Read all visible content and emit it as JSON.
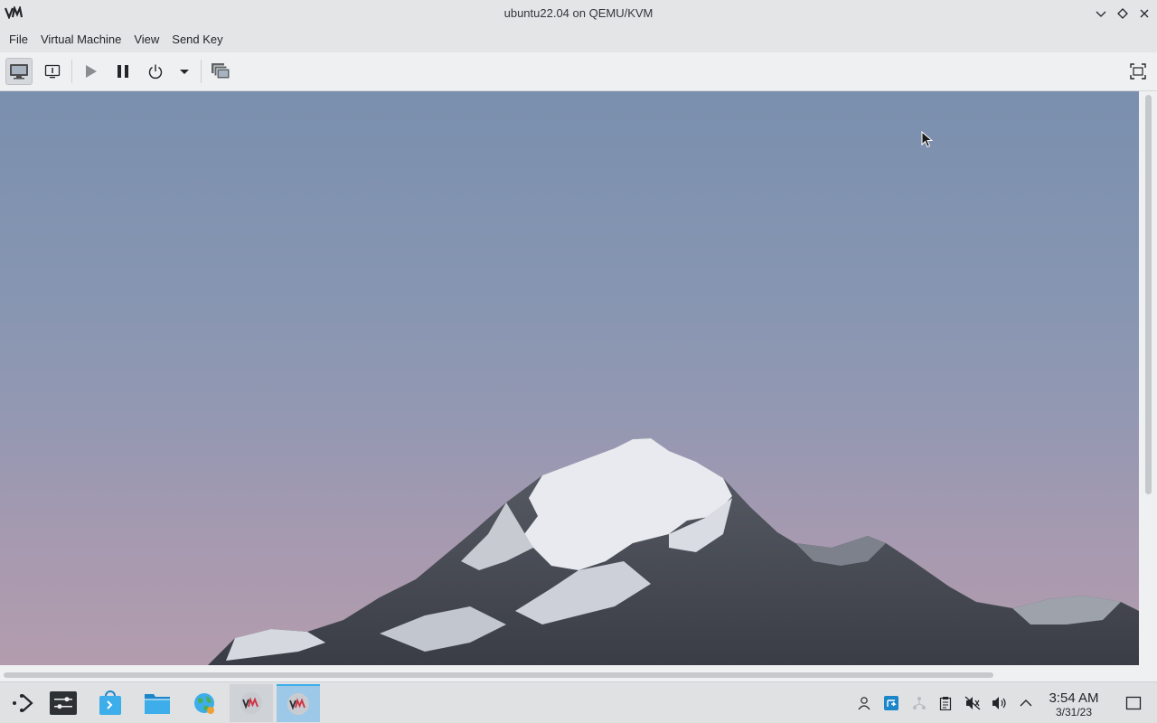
{
  "window": {
    "title": "ubuntu22.04 on QEMU/KVM",
    "app_logo": "VM"
  },
  "menubar": {
    "items": [
      "File",
      "Virtual Machine",
      "View",
      "Send Key"
    ]
  },
  "toolbar": {
    "buttons": [
      {
        "name": "console",
        "icon": "monitor-icon",
        "active": true
      },
      {
        "name": "details",
        "icon": "info-icon"
      },
      {
        "name": "run",
        "icon": "play-icon"
      },
      {
        "name": "pause",
        "icon": "pause-icon"
      },
      {
        "name": "shutdown",
        "icon": "power-icon"
      },
      {
        "name": "shutdown-menu",
        "icon": "dropdown-arrow-icon"
      },
      {
        "name": "snapshots",
        "icon": "snapshots-icon"
      },
      {
        "name": "fullscreen",
        "icon": "fullscreen-icon"
      }
    ]
  },
  "taskbar": {
    "launchers": [
      {
        "name": "application-launcher",
        "icon": "kde-launcher-icon"
      },
      {
        "name": "system-settings",
        "icon": "settings-icon"
      },
      {
        "name": "discover",
        "icon": "store-icon"
      },
      {
        "name": "file-manager",
        "icon": "folder-icon"
      },
      {
        "name": "web-browser",
        "icon": "globe-icon"
      },
      {
        "name": "virt-manager",
        "icon": "vm-icon",
        "state": "running"
      },
      {
        "name": "virt-manager-viewer",
        "icon": "vm-icon",
        "state": "active"
      }
    ],
    "tray": [
      "user-icon",
      "remote-desktop-icon",
      "network-icon",
      "clipboard-icon",
      "mute-icon",
      "volume-icon",
      "chevron-up-icon"
    ],
    "clock": {
      "time": "3:54 AM",
      "date": "3/31/23"
    },
    "show_desktop": "show-desktop-icon"
  }
}
